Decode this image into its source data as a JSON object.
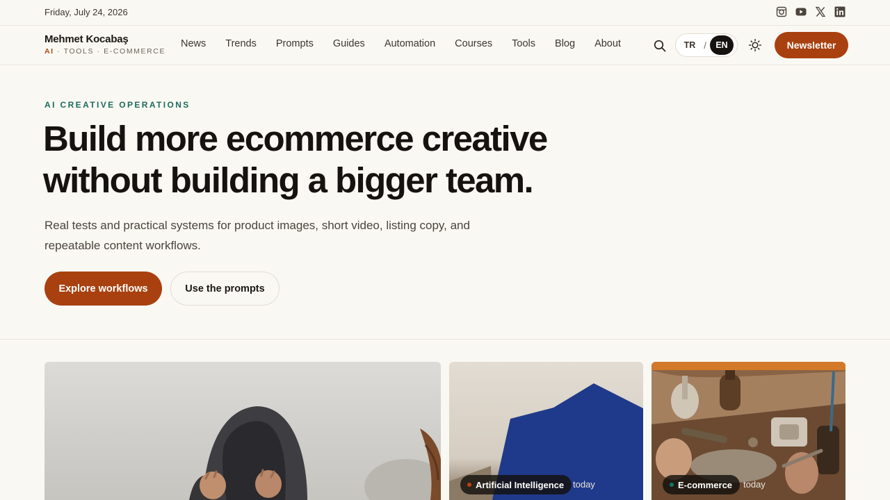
{
  "topbar": {
    "date": "Friday, July 24, 2026",
    "socials": [
      "instagram-icon",
      "youtube-icon",
      "x-icon",
      "linkedin-icon"
    ]
  },
  "brand": {
    "name": "Mehmet Kocabaş",
    "tag_ai": "AI",
    "tag_rest": " · TOOLS · E-COMMERCE"
  },
  "nav": {
    "items": [
      {
        "label": "News"
      },
      {
        "label": "Trends"
      },
      {
        "label": "Prompts"
      },
      {
        "label": "Guides"
      },
      {
        "label": "Automation"
      },
      {
        "label": "Courses"
      },
      {
        "label": "Tools"
      },
      {
        "label": "Blog"
      },
      {
        "label": "About"
      }
    ],
    "search_icon": "search-icon",
    "theme_icon": "sun-icon",
    "newsletter_label": "Newsletter"
  },
  "language": {
    "options": [
      "TR",
      "EN"
    ],
    "separator": "/",
    "selected": "EN"
  },
  "hero": {
    "eyebrow": "AI CREATIVE OPERATIONS",
    "headline_line1": "Build more ecommerce creative",
    "headline_line2": "without building a bigger team.",
    "subtitle_line1": "Real tests and practical systems for product images, short video, listing copy, and",
    "subtitle_line2": "repeatable content workflows.",
    "primary_cta": "Explore workflows",
    "secondary_cta": "Use the prompts"
  },
  "cards": [
    {
      "category": "",
      "time": ""
    },
    {
      "category": "Artificial Intelligence",
      "time": "today",
      "dot_color": "#c2410c"
    },
    {
      "category": "E-commerce",
      "time": "today",
      "dot_color": "#0f766e"
    }
  ],
  "colors": {
    "accent": "#a8410f",
    "eyebrow": "#1d6a5e",
    "background": "#faf8f3"
  }
}
